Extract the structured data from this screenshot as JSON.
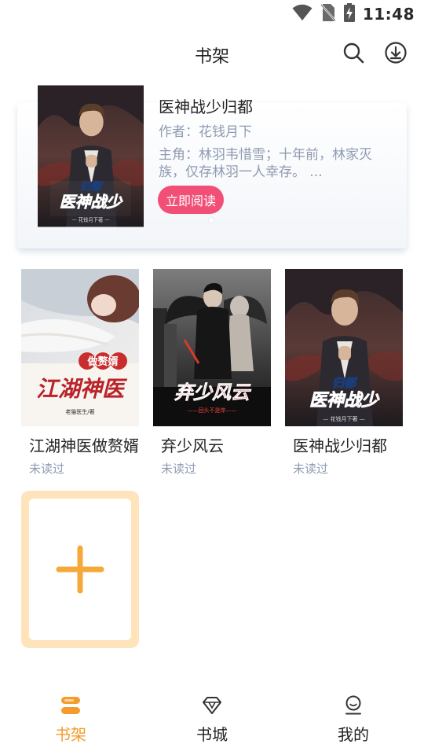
{
  "status_bar": {
    "time": "11:48",
    "icons": [
      "wifi-icon",
      "no-sim-icon",
      "battery-charging-icon"
    ]
  },
  "header": {
    "title": "书架",
    "icons": [
      "search-icon",
      "download-icon"
    ]
  },
  "featured": {
    "title": "医神战少归都",
    "author": "作者：花钱月下",
    "description": "主角：林羽韦惜雪；十年前，林家灭族，仅存林羽一人幸存。 ...",
    "read_button": "立即阅读",
    "cover": {
      "title_small": "归都",
      "title_big": "医神战少",
      "byline": "— 花钱月下著 —"
    }
  },
  "books": [
    {
      "title": "江湖神医做赘婿",
      "status": "未读过",
      "cover": {
        "title_small": "做赘婿",
        "title_big": "江湖神医",
        "byline": "老猫医生/著"
      }
    },
    {
      "title": "弃少风云",
      "status": "未读过",
      "cover": {
        "title_big": "弃少风云",
        "byline": "——回头不是岸——"
      }
    },
    {
      "title": "医神战少归都",
      "status": "未读过",
      "cover": {
        "title_small": "归都",
        "title_big": "医神战少",
        "byline": "— 花钱月下著 —"
      }
    }
  ],
  "add_book": {
    "icon": "plus-icon"
  },
  "bottom_nav": {
    "items": [
      {
        "label": "书架",
        "icon": "bookshelf-icon",
        "active": true
      },
      {
        "label": "书城",
        "icon": "diamond-icon",
        "active": false
      },
      {
        "label": "我的",
        "icon": "profile-icon",
        "active": false
      }
    ]
  },
  "colors": {
    "accent": "#f59b2c",
    "read_button": "#f24f76",
    "secondary_text": "#8f9bb0",
    "add_book_border": "#ffe3ba"
  }
}
